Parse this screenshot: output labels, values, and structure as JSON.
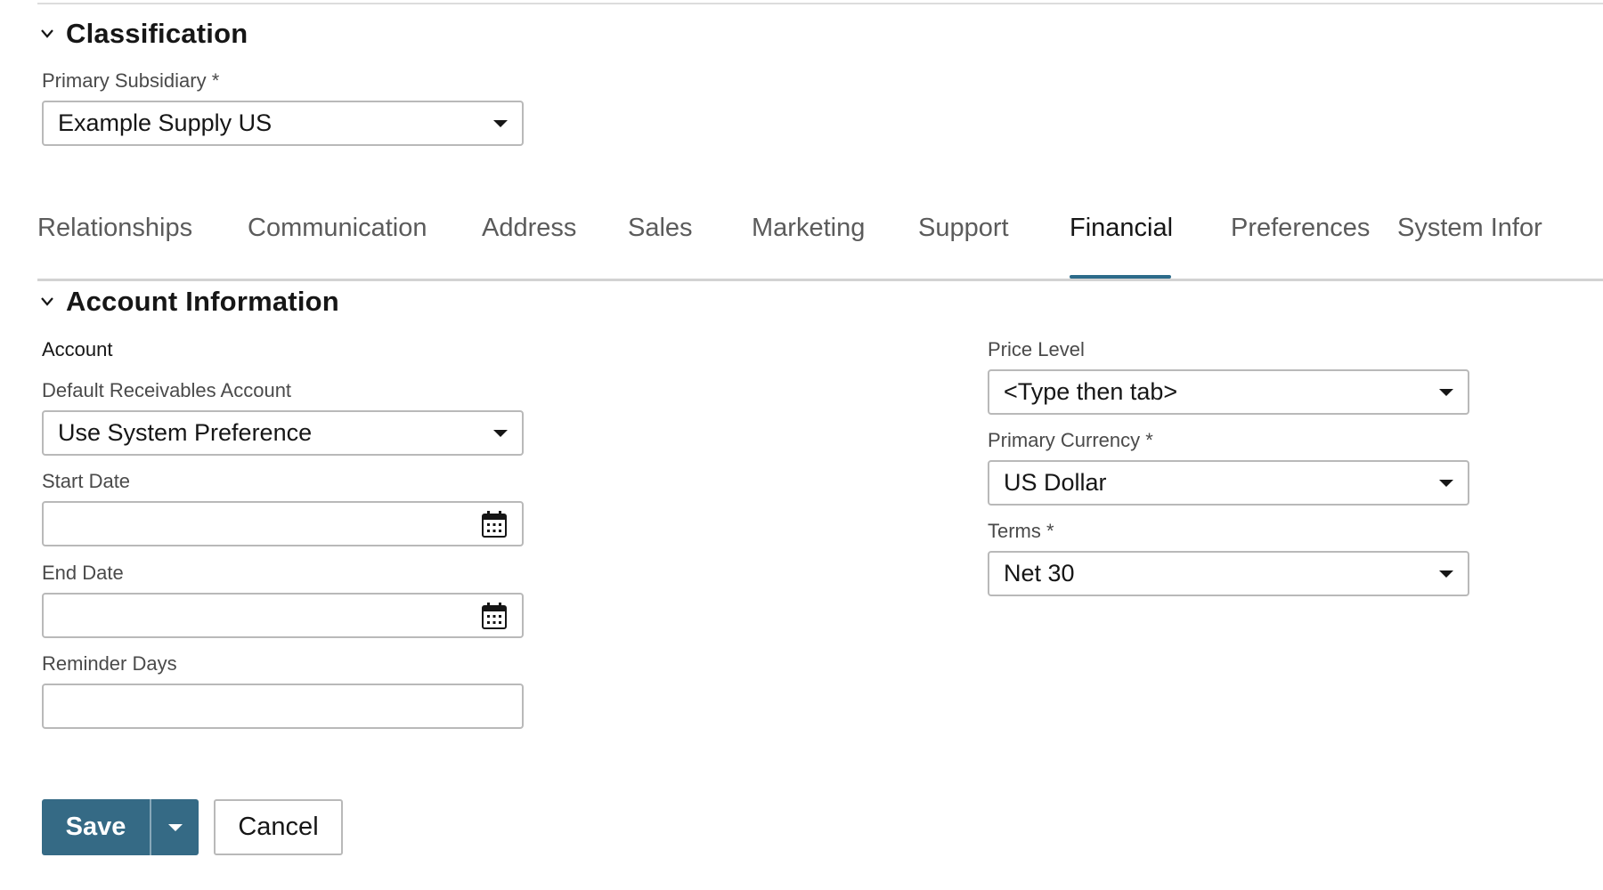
{
  "classification": {
    "title": "Classification",
    "primary_subsidiary": {
      "label": "Primary Subsidiary *",
      "value": "Example Supply US"
    }
  },
  "tabs": [
    {
      "label": "Relationships",
      "active": false
    },
    {
      "label": "Communication",
      "active": false
    },
    {
      "label": "Address",
      "active": false
    },
    {
      "label": "Sales",
      "active": false
    },
    {
      "label": "Marketing",
      "active": false
    },
    {
      "label": "Support",
      "active": false
    },
    {
      "label": "Financial",
      "active": true
    },
    {
      "label": "Preferences",
      "active": false
    },
    {
      "label": "System Infor",
      "active": false
    }
  ],
  "account_info": {
    "title": "Account Information",
    "account_label": "Account",
    "default_receivables": {
      "label": "Default Receivables Account",
      "value": "Use System Preference"
    },
    "start_date": {
      "label": "Start Date",
      "value": ""
    },
    "end_date": {
      "label": "End Date",
      "value": ""
    },
    "reminder_days": {
      "label": "Reminder Days",
      "value": ""
    },
    "price_level": {
      "label": "Price Level",
      "value": "<Type then tab>"
    },
    "primary_currency": {
      "label": "Primary Currency *",
      "value": "US Dollar"
    },
    "terms": {
      "label": "Terms *",
      "value": "Net 30"
    }
  },
  "actions": {
    "save_label": "Save",
    "cancel_label": "Cancel"
  },
  "icons": {
    "collapse": "chevron-down-icon",
    "dropdown": "caret-down-icon",
    "calendar": "calendar-icon"
  },
  "colors": {
    "accent": "#2c6b8a",
    "save_button": "#356a85",
    "field_border": "#b9b9b9",
    "text": "#161616"
  }
}
